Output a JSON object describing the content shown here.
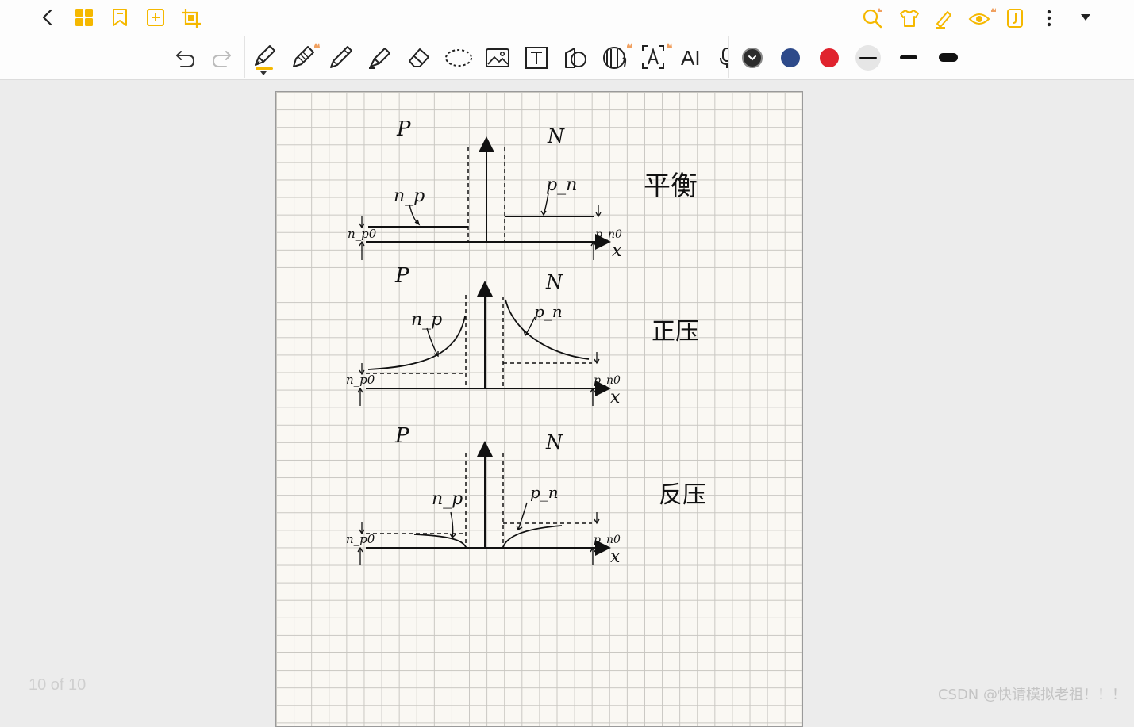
{
  "toolbar_top": {
    "back_icon": "chevron-left-icon",
    "left_tools": [
      "grid-view-icon",
      "bookmark-icon",
      "add-page-icon",
      "crop-icon"
    ],
    "right_tools": [
      "search-icon",
      "shirt-icon",
      "highlighter-icon",
      "eye-icon",
      "notebook-icon",
      "more-icon",
      "dropdown-icon"
    ],
    "accent_color": "#f5b800"
  },
  "toolbar_tools": {
    "items": [
      "undo-icon",
      "redo-icon",
      "fountain-pen-icon",
      "pencil-icon",
      "ballpoint-icon",
      "highlighter-icon",
      "eraser-icon",
      "lasso-icon",
      "image-icon",
      "text-box-icon",
      "shape-icon",
      "sticker-icon",
      "ocr-icon",
      "ai-text-icon",
      "microphone-icon"
    ],
    "ai_label": "AI",
    "colors": [
      "#2c2c2c",
      "#2e4a8a",
      "#e0232e"
    ],
    "stroke_sizes": [
      "thin",
      "medium",
      "thick"
    ]
  },
  "note": {
    "diagram1": {
      "left_label": "P",
      "right_label": "N",
      "np": "n_p",
      "pn": "p_n",
      "np0": "n_p0",
      "pn0": "p_n0",
      "x": "x",
      "caption": "平衡"
    },
    "diagram2": {
      "left_label": "P",
      "right_label": "N",
      "np": "n_p",
      "pn": "p_n",
      "np0": "n_p0",
      "pn0": "p_n0",
      "x": "x",
      "caption": "正压"
    },
    "diagram3": {
      "left_label": "P",
      "right_label": "N",
      "np": "n_p",
      "pn": "p_n",
      "np0": "n_p0",
      "pn0": "p_n0",
      "x": "x",
      "caption": "反压"
    }
  },
  "status": {
    "page_counter": "10 of 10",
    "watermark": "CSDN @快请模拟老祖！！！"
  }
}
